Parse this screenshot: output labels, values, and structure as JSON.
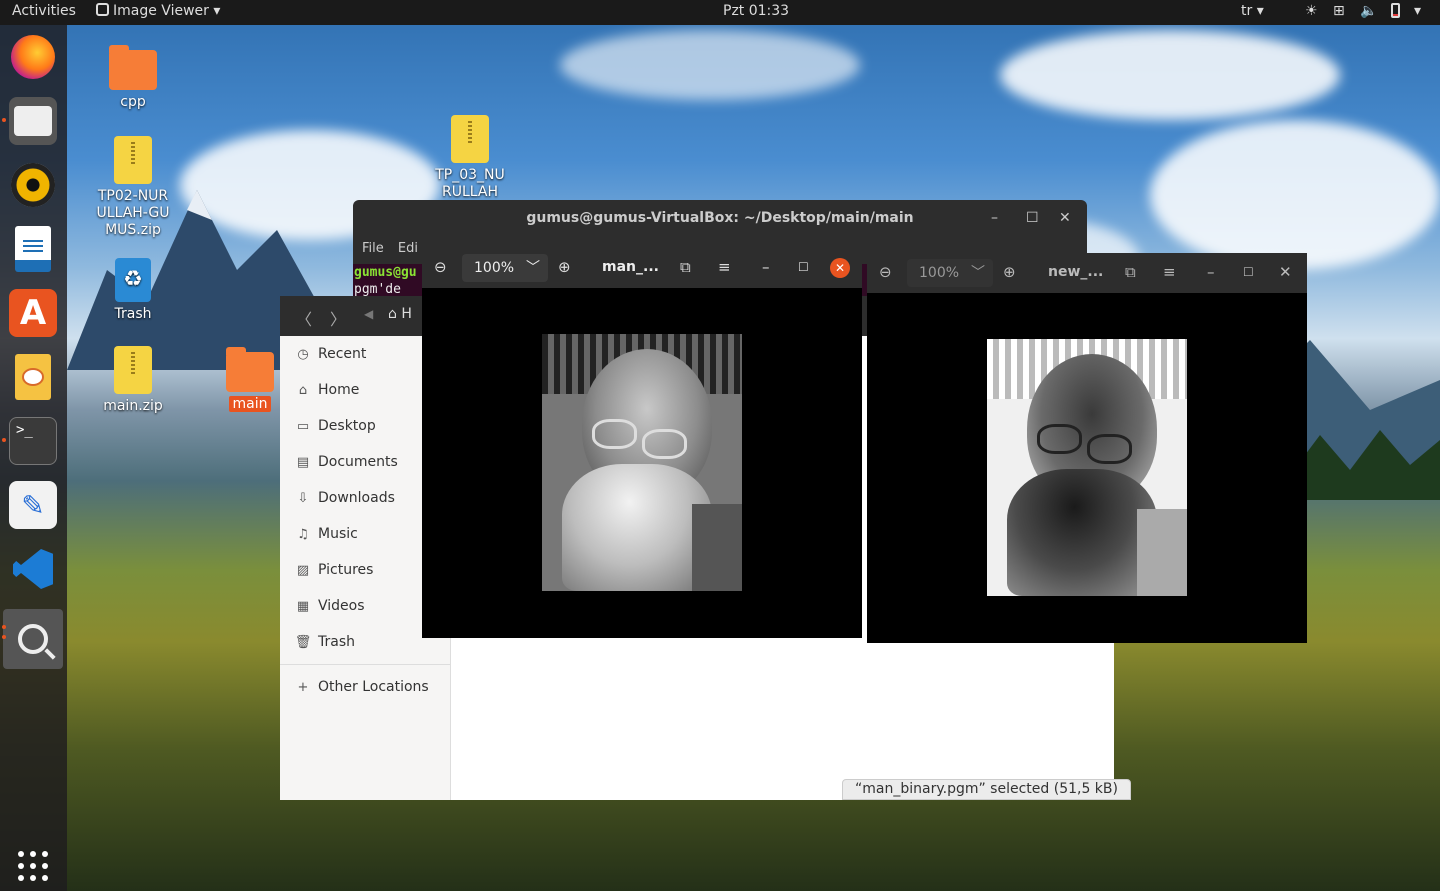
{
  "topbar": {
    "activities": "Activities",
    "app_name": "Image Viewer",
    "clock": "Pzt 01:33",
    "input_method": "tr"
  },
  "desktop": {
    "icons": [
      {
        "label": "cpp"
      },
      {
        "label": "TP02-NURULLAH-GUMUS.zip"
      },
      {
        "label": "Trash"
      },
      {
        "label": "main.zip"
      },
      {
        "label": "main"
      },
      {
        "label": "TP_03_NURULLAH"
      }
    ]
  },
  "terminal": {
    "title": "gumus@gumus-VirtualBox: ~/Desktop/main/main",
    "menu_file": "File",
    "menu_edit": "Edi",
    "line1": "gumus@gu",
    "line2": "pgm'de"
  },
  "files": {
    "path_home": "H",
    "sidebar": [
      {
        "label": "Recent",
        "icon": "clock-icon"
      },
      {
        "label": "Home",
        "icon": "home-icon"
      },
      {
        "label": "Desktop",
        "icon": "desktop-icon"
      },
      {
        "label": "Documents",
        "icon": "document-icon"
      },
      {
        "label": "Downloads",
        "icon": "download-icon"
      },
      {
        "label": "Music",
        "icon": "music-icon"
      },
      {
        "label": "Pictures",
        "icon": "picture-icon"
      },
      {
        "label": "Videos",
        "icon": "video-icon"
      },
      {
        "label": "Trash",
        "icon": "trash-icon"
      }
    ],
    "other_locations": "Other Locations",
    "status": "“man_binary.pgm” selected  (51,5 kB)"
  },
  "viewer1": {
    "zoom": "100%",
    "title": "man_..."
  },
  "viewer2": {
    "zoom": "100%",
    "title": "new_..."
  },
  "colors": {
    "accent": "#e95420",
    "dark": "#2d2d2d"
  }
}
